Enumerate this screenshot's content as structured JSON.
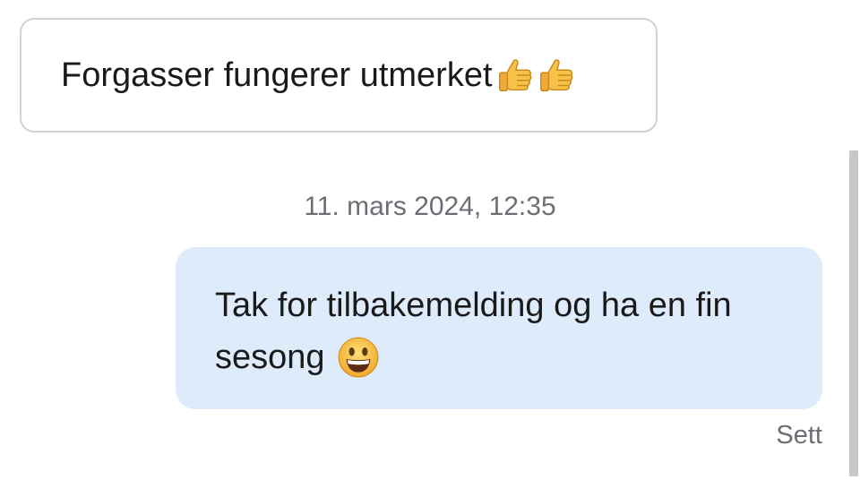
{
  "messages": {
    "incoming": {
      "text": "Forgasser fungerer utmerket",
      "emojis": [
        "thumbs-up-icon",
        "thumbs-up-icon"
      ]
    },
    "timestamp": "11. mars 2024, 12:35",
    "outgoing": {
      "line1": "Tak for tilbakemelding og ha en fin",
      "line2": "sesong",
      "emoji": "grinning-face-icon"
    },
    "status": "Sett"
  },
  "colors": {
    "incoming_bubble_border": "#cfd2d6",
    "outgoing_bubble_bg": "#deebfb",
    "meta_text": "#6b6f75",
    "scrollbar": "#c7c7c7"
  }
}
